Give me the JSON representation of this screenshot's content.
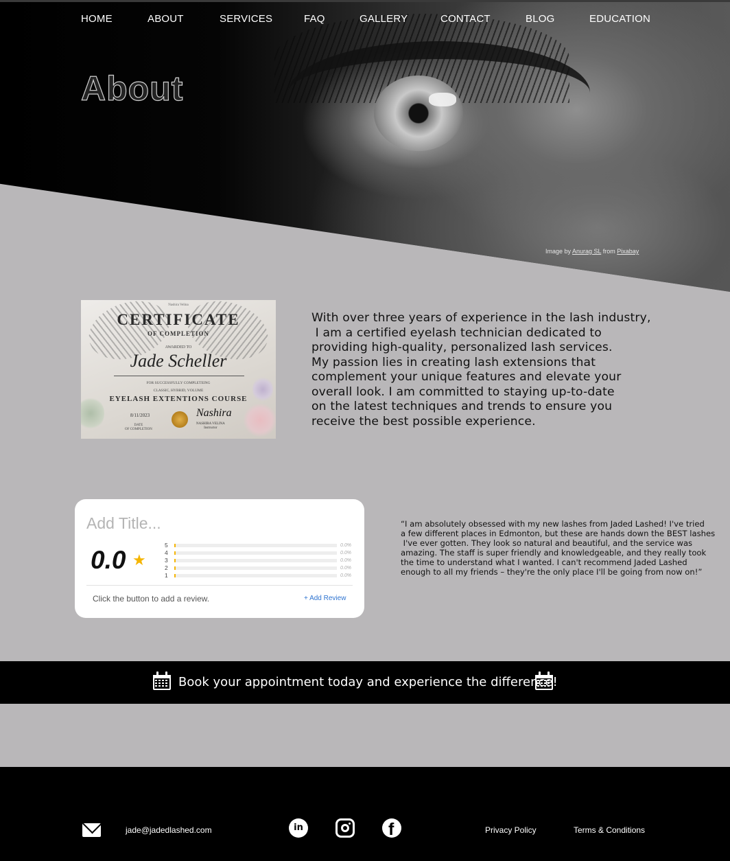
{
  "nav": {
    "items": [
      "HOME",
      "ABOUT",
      "SERVICES",
      "FAQ",
      "GALLERY",
      "CONTACT",
      "BLOG",
      "EDUCATION"
    ]
  },
  "hero": {
    "title": "About",
    "credit_prefix": "Image by ",
    "credit_author": "Anurag SL",
    "credit_mid": " from ",
    "credit_source": "Pixabay"
  },
  "certificate": {
    "top_small": "Nashira Velina",
    "title": "CERTIFICATE",
    "subtitle": "OF COMPLETION",
    "awarded": "AWARDED TO",
    "name": "Jade Scheller",
    "for_line1": "FOR SUCCESSFULLY COMPLETEING",
    "for_line2": "CLASSIC, HYBRID, VOLUME",
    "course": "EYELASH EXTENTIONS COURSE",
    "date": "8/11/2023",
    "date_label1": "DATE",
    "date_label2": "OF COMPLETION",
    "signature": "Nashira",
    "instructor_name": "NASHIRA VELINA",
    "instructor_label": "Instructor"
  },
  "about": {
    "lines": [
      "With over three years of experience in the lash industry,",
      " I am a certified eyelash technician dedicated to",
      "providing high-quality, personalized lash services.",
      "My passion lies in creating lash extensions that",
      "complement your unique features and elevate your",
      "overall look. I am committed to staying up-to-date",
      "on the latest techniques and trends to ensure you",
      "receive the best possible experience."
    ]
  },
  "review": {
    "title_placeholder": "Add Title...",
    "score": "0.0",
    "star": "★",
    "rows": [
      {
        "label": "5",
        "pct": "0.0%"
      },
      {
        "label": "4",
        "pct": "0.0%"
      },
      {
        "label": "3",
        "pct": "0.0%"
      },
      {
        "label": "2",
        "pct": "0.0%"
      },
      {
        "label": "1",
        "pct": "0.0%"
      }
    ],
    "hint": "Click the button to add a review.",
    "add_label": "+ Add Review"
  },
  "testimonial": {
    "lines": [
      "“I am absolutely obsessed with my new lashes from Jaded Lashed! I've tried",
      "a few different places in Edmonton, but these are hands down the BEST lashes",
      " I've ever gotten. They look so natural and beautiful, and the service was",
      "amazing. The staff is super friendly and knowledgeable, and they really took",
      "the time to understand what I wanted. I can't recommend Jaded Lashed",
      "enough to all my friends – they're the only place I'll be going from now on!”"
    ]
  },
  "booking": {
    "text": "Book your appointment today and experience the difference!"
  },
  "footer": {
    "email": "jade@jadedlashed.com",
    "linkedin_glyph": "in",
    "facebook_glyph": "f",
    "privacy": "Privacy Policy",
    "terms": "Terms & Conditions"
  },
  "colors": {
    "page_bg": "#b9b7b9",
    "dark": "#000000",
    "star": "#f5b500",
    "link_blue": "#2f74d0"
  }
}
